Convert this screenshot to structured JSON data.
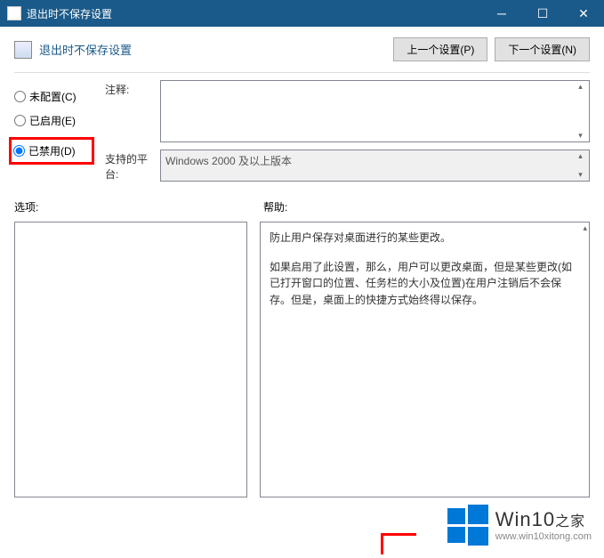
{
  "window": {
    "title": "退出时不保存设置"
  },
  "header": {
    "title": "退出时不保存设置",
    "prev_btn": "上一个设置(P)",
    "next_btn": "下一个设置(N)"
  },
  "radios": {
    "not_configured": "未配置(C)",
    "enabled": "已启用(E)",
    "disabled": "已禁用(D)"
  },
  "fields": {
    "comment_label": "注释:",
    "comment_value": "",
    "platform_label": "支持的平台:",
    "platform_value": "Windows 2000 及以上版本"
  },
  "section_labels": {
    "options": "选项:",
    "help": "帮助:"
  },
  "help": {
    "p1": "防止用户保存对桌面进行的某些更改。",
    "p2": "如果启用了此设置，那么，用户可以更改桌面，但是某些更改(如已打开窗口的位置、任务栏的大小及位置)在用户注销后不会保存。但是，桌面上的快捷方式始终得以保存。"
  },
  "watermark": {
    "brand": "Win10",
    "brand_suffix": "之家",
    "url": "www.win10xitong.com"
  }
}
